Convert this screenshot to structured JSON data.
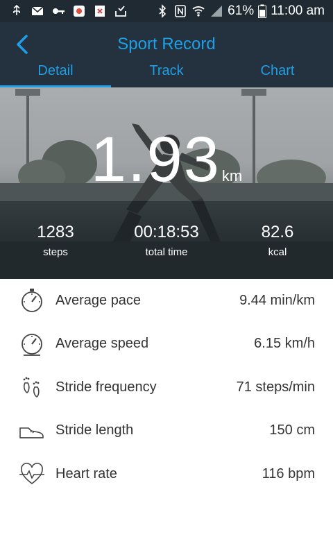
{
  "status_bar": {
    "battery": "61%",
    "time": "11:00 am",
    "icons": [
      "usb-icon",
      "mail-icon",
      "key-icon",
      "app-icon",
      "close-box-icon",
      "inbox-icon",
      "bluetooth-icon",
      "nfc-icon",
      "wifi-icon",
      "signal-icon",
      "battery-icon"
    ]
  },
  "header": {
    "title": "Sport Record",
    "back_icon": "chevron-left-icon",
    "tabs": [
      {
        "label": "Detail",
        "active": true
      },
      {
        "label": "Track",
        "active": false
      },
      {
        "label": "Chart",
        "active": false
      }
    ]
  },
  "hero": {
    "distance": "1.93",
    "distance_unit": "km",
    "stats": [
      {
        "value": "1283",
        "label": "steps"
      },
      {
        "value": "00:18:53",
        "label": "total time"
      },
      {
        "value": "82.6",
        "label": "kcal"
      }
    ]
  },
  "metrics": [
    {
      "icon": "stopwatch-icon",
      "label": "Average pace",
      "value": "9.44 min/km"
    },
    {
      "icon": "speedometer-icon",
      "label": "Average speed",
      "value": "6.15 km/h"
    },
    {
      "icon": "footprints-icon",
      "label": "Stride frequency",
      "value": "71 steps/min"
    },
    {
      "icon": "shoe-icon",
      "label": "Stride length",
      "value": "150 cm"
    },
    {
      "icon": "heart-rate-icon",
      "label": "Heart rate",
      "value": "116 bpm"
    }
  ],
  "colors": {
    "accent": "#1e9fe6",
    "header_bg": "#243240",
    "status_bar_bg": "#1f2a33",
    "text_dark": "#333333"
  }
}
